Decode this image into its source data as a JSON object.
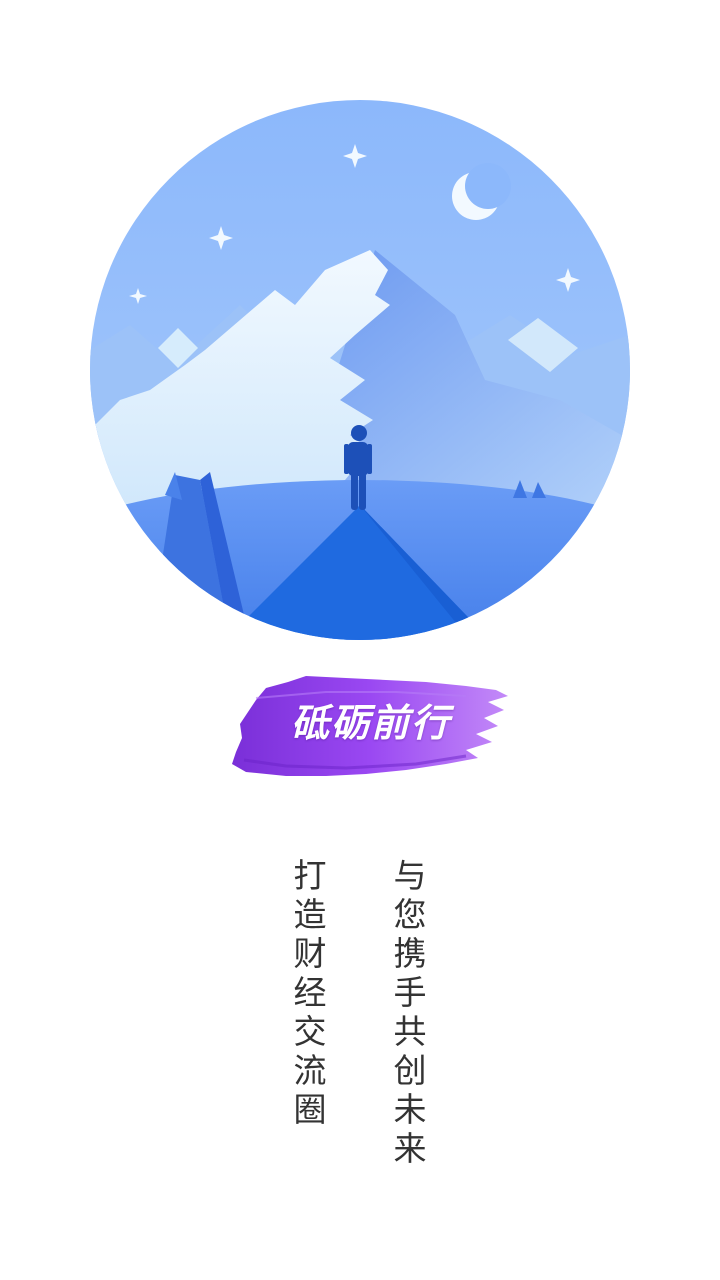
{
  "illustration": {
    "icon": "mountain-night-landscape"
  },
  "slogan": {
    "text": "砥砺前行",
    "brush_color": "#8e3ff0"
  },
  "taglines": {
    "left": "打造财经交流圈",
    "right": "与您携手共创未来",
    "color": "#333333"
  }
}
